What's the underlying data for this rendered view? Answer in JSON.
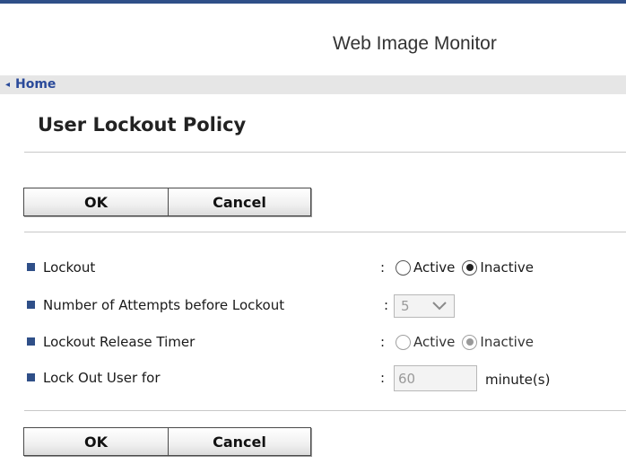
{
  "header": {
    "brand": "Web Image Monitor"
  },
  "breadcrumb": {
    "chevron": "◂",
    "home_label": "Home"
  },
  "page": {
    "title": "User Lockout Policy"
  },
  "buttons": {
    "ok_label": "OK",
    "cancel_label": "Cancel"
  },
  "fields": {
    "lockout": {
      "label": "Lockout",
      "separator": ":",
      "options": [
        "Active",
        "Inactive"
      ],
      "selected": "Inactive",
      "enabled": true
    },
    "attempts": {
      "label": "Number of Attempts before Lockout",
      "separator": ":",
      "value": "5",
      "enabled": false
    },
    "release_timer": {
      "label": "Lockout Release Timer",
      "separator": ":",
      "options": [
        "Active",
        "Inactive"
      ],
      "selected": "Inactive",
      "enabled": false
    },
    "lock_out_for": {
      "label": "Lock Out User for",
      "separator": ":",
      "value": "60",
      "unit": "minute(s)",
      "enabled": false
    }
  },
  "colors": {
    "accent": "#2f4f88",
    "link": "#2a4a9a",
    "breadcrumb_bg": "#e6e6e6"
  }
}
